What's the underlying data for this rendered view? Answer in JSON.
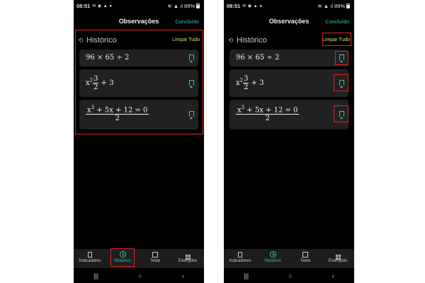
{
  "status_bar": {
    "time": "08:51",
    "notification_icons": "✉ ◉ ▲ ●",
    "signal": "≋ ▲ ıl",
    "battery": "89%"
  },
  "header": {
    "title": "Observações",
    "done_label": "Concluído"
  },
  "history": {
    "title": "Histórico",
    "clear_label": "Limpar Tudo",
    "items": [
      {
        "a": "96",
        "op1": "×",
        "b": "65",
        "op2": "÷",
        "c": "2"
      },
      {
        "base": "x",
        "exp": "2",
        "num": "3",
        "den": "2",
        "rest": "+ 3"
      },
      {
        "num_x": "x",
        "num_exp": "3",
        "num_rest": "+ 5x + 12 = 0",
        "den": "2"
      }
    ]
  },
  "tabs": [
    {
      "label": "Indicadores",
      "icon": "bookmark-icon"
    },
    {
      "label": "Histórico",
      "icon": "history-icon"
    },
    {
      "label": "Teste",
      "icon": "test-icon"
    },
    {
      "label": "Exemplos",
      "icon": "examples-grid-icon"
    }
  ],
  "active_tab": "Histórico",
  "nav": {
    "recent": "|||",
    "home": "○",
    "back": "‹"
  },
  "colors": {
    "accent": "#39c5b5",
    "clear_text": "#c8e66a",
    "highlight": "#e02424",
    "card": "#212121",
    "background": "#000000"
  }
}
